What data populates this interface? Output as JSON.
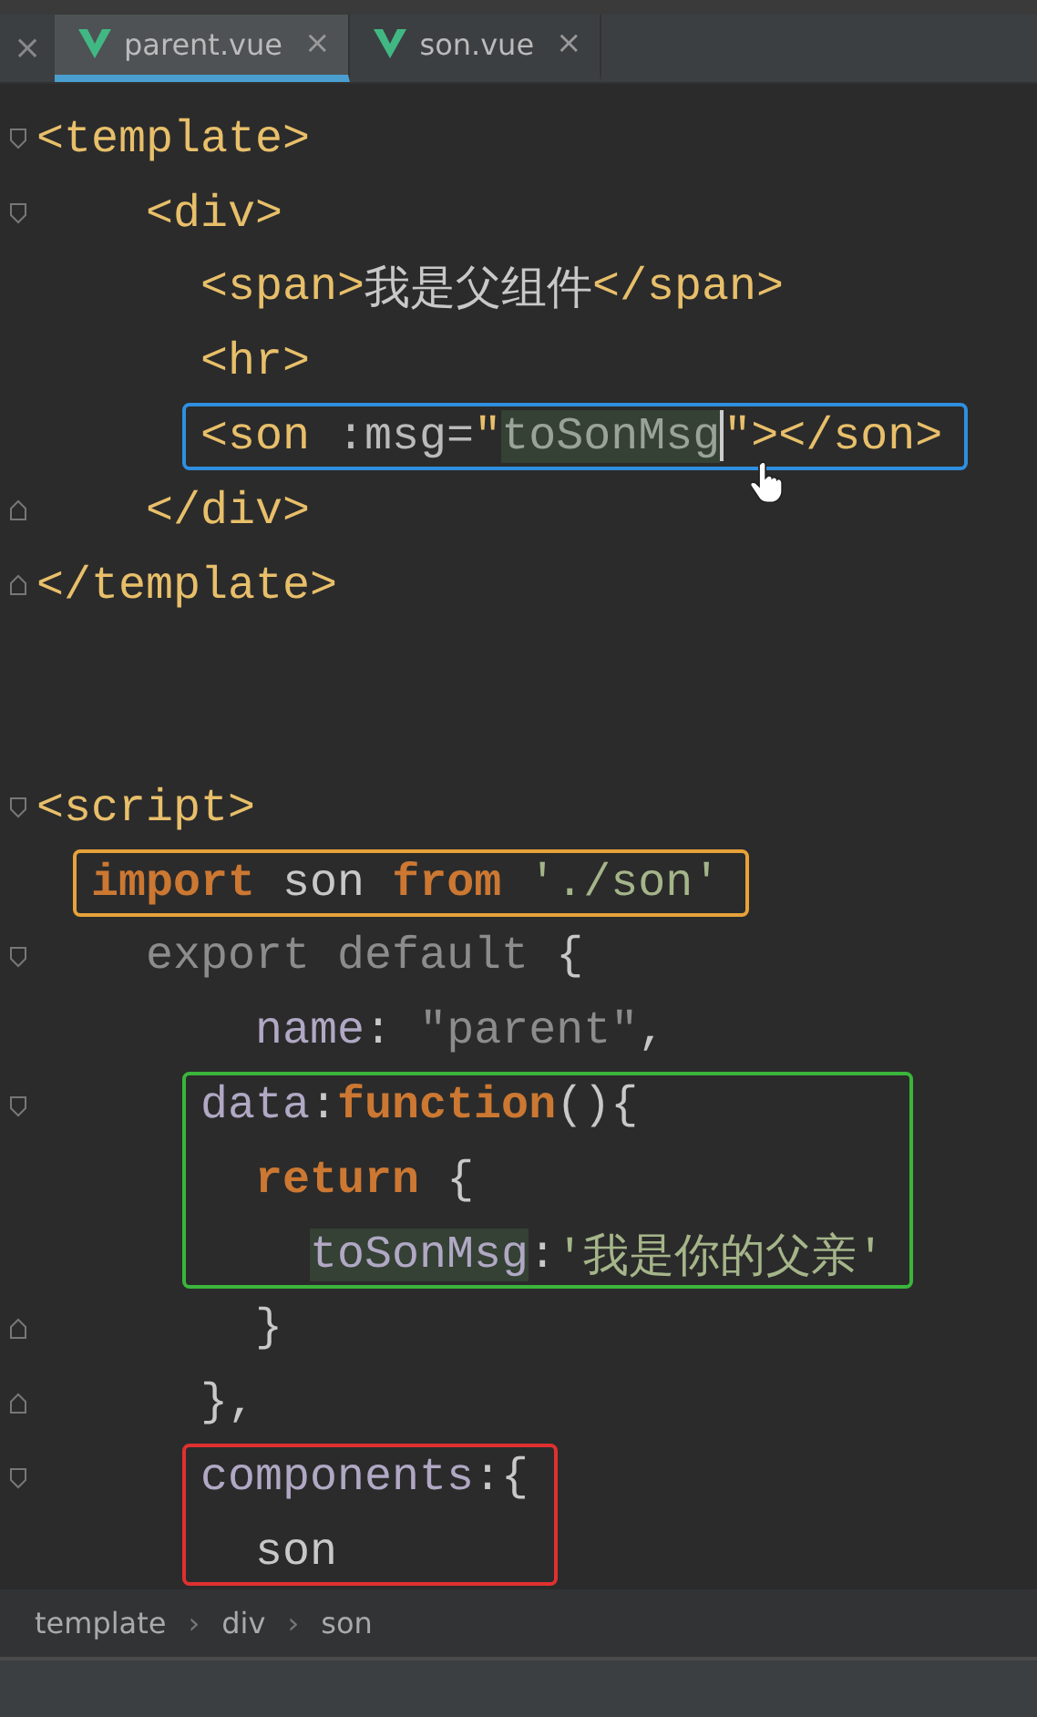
{
  "stray_close": "×",
  "tabs": [
    {
      "label": "parent.vue",
      "close": "×",
      "selected": true
    },
    {
      "label": "son.vue",
      "close": "×",
      "selected": false
    }
  ],
  "code": [
    {
      "kind": "fold_start",
      "tokens": [
        {
          "kind": "tag",
          "t": "<template>"
        }
      ]
    },
    {
      "kind": "fold_start",
      "tokens": [
        {
          "kind": "tag",
          "t": "    <div>"
        }
      ]
    },
    {
      "kind": "line",
      "tokens": [
        {
          "kind": "tag",
          "t": "      <span>"
        },
        {
          "kind": "plain",
          "t": "我是父组件"
        },
        {
          "kind": "tag",
          "t": "</span>"
        }
      ]
    },
    {
      "kind": "line",
      "tokens": [
        {
          "kind": "tag",
          "t": "      <hr>"
        }
      ]
    },
    {
      "kind": "frame",
      "color": "#2f8fe0",
      "lines": [
        {
          "kind": "line",
          "tokens": [
            {
              "kind": "tag",
              "t": "      <son"
            },
            {
              "kind": "attr",
              "t": " :msg="
            },
            {
              "kind": "tag",
              "t": "\""
            },
            {
              "kind": "dim",
              "t": "toSonMsg",
              "hl": true,
              "caret": true
            },
            {
              "kind": "tag",
              "t": "\"></son>"
            }
          ]
        }
      ]
    },
    {
      "kind": "fold_end",
      "tokens": [
        {
          "kind": "tag",
          "t": "    </div>"
        }
      ]
    },
    {
      "kind": "fold_end",
      "tokens": [
        {
          "kind": "tag",
          "t": "</template>"
        }
      ]
    },
    {
      "kind": "blank"
    },
    {
      "kind": "blank"
    },
    {
      "kind": "fold_start",
      "tokens": [
        {
          "kind": "tag",
          "t": "<script>"
        }
      ]
    },
    {
      "kind": "frame",
      "color": "#e8a23a",
      "lines": [
        {
          "kind": "line",
          "tokens": [
            {
              "kind": "keyword",
              "t": "  import"
            },
            {
              "kind": "plain",
              "t": " son "
            },
            {
              "kind": "keyword",
              "t": "from"
            },
            {
              "kind": "string",
              "t": " './son'"
            }
          ]
        }
      ]
    },
    {
      "kind": "fold_start",
      "tokens": [
        {
          "kind": "dim",
          "t": "    export default"
        },
        {
          "kind": "plain",
          "t": " {"
        }
      ]
    },
    {
      "kind": "line",
      "tokens": [
        {
          "kind": "key",
          "t": "        name"
        },
        {
          "kind": "plain",
          "t": ": "
        },
        {
          "kind": "dim",
          "t": "\"parent\""
        },
        {
          "kind": "plain",
          "t": ","
        }
      ]
    },
    {
      "kind": "frame",
      "color": "#3bb53b",
      "lines": [
        {
          "kind": "fold_start",
          "tokens": [
            {
              "kind": "key",
              "t": "      data"
            },
            {
              "kind": "plain",
              "t": ":"
            },
            {
              "kind": "keyword",
              "t": "function"
            },
            {
              "kind": "plain",
              "t": "(){"
            }
          ]
        },
        {
          "kind": "line",
          "tokens": [
            {
              "kind": "keyword",
              "t": "        return"
            },
            {
              "kind": "plain",
              "t": " {"
            }
          ]
        },
        {
          "kind": "line",
          "tokens": [
            {
              "kind": "key",
              "t": "          toSonMsg",
              "hl": true
            },
            {
              "kind": "plain",
              "t": ":"
            },
            {
              "kind": "string",
              "t": "'我是你的父亲'"
            }
          ]
        }
      ]
    },
    {
      "kind": "fold_end",
      "tokens": [
        {
          "kind": "plain",
          "t": "        }"
        }
      ]
    },
    {
      "kind": "fold_end",
      "tokens": [
        {
          "kind": "plain",
          "t": "      },"
        }
      ]
    },
    {
      "kind": "frame",
      "color": "#e03030",
      "lines": [
        {
          "kind": "fold_start",
          "tokens": [
            {
              "kind": "key",
              "t": "      components"
            },
            {
              "kind": "plain",
              "t": ":{"
            }
          ]
        },
        {
          "kind": "line",
          "tokens": [
            {
              "kind": "plain",
              "t": "        son"
            }
          ]
        }
      ]
    }
  ],
  "breadcrumb": [
    {
      "label": "template"
    },
    {
      "separator": "›",
      "label": "div"
    },
    {
      "separator": "›",
      "label": "son"
    }
  ]
}
